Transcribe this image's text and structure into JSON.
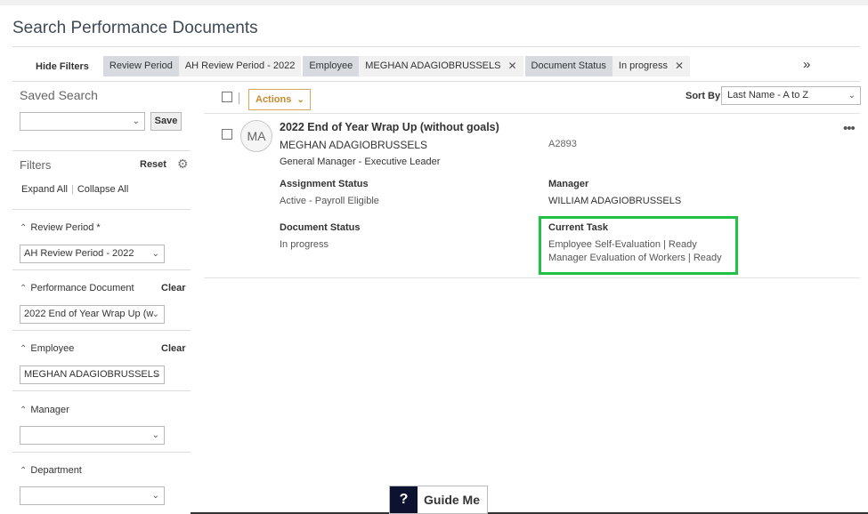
{
  "page": {
    "title": "Search Performance Documents"
  },
  "filterbar": {
    "hide_filters": "Hide Filters",
    "chips": [
      {
        "label": "Review Period",
        "value": "AH Review Period - 2022",
        "closable": false
      },
      {
        "label": "Employee",
        "value": "MEGHAN ADAGIOBRUSSELS",
        "closable": true
      },
      {
        "label": "Document Status",
        "value": "In progress",
        "closable": true
      }
    ],
    "overflow": "»",
    "close_glyph": "✕"
  },
  "sidebar": {
    "saved_search_title": "Saved Search",
    "saved_search_value": "",
    "save_label": "Save",
    "filters_title": "Filters",
    "reset_label": "Reset",
    "expand_all": "Expand All",
    "collapse_all": "Collapse All",
    "sections": [
      {
        "label": "Review Period *",
        "clear": "",
        "value": "AH Review Period - 2022"
      },
      {
        "label": "Performance Document",
        "clear": "Clear",
        "value": "2022 End of Year Wrap Up (w"
      },
      {
        "label": "Employee",
        "clear": "Clear",
        "value": "MEGHAN ADAGIOBRUSSELS"
      },
      {
        "label": "Manager",
        "clear": "",
        "value": ""
      },
      {
        "label": "Department",
        "clear": "",
        "value": ""
      }
    ]
  },
  "toolbar": {
    "actions_label": "Actions",
    "sort_by_label": "Sort By",
    "sort_value": "Last Name - A to Z"
  },
  "result": {
    "avatar_initials": "MA",
    "title": "2022 End of Year Wrap Up (without goals)",
    "employee_name": "MEGHAN ADAGIOBRUSSELS",
    "employee_id": "A2893",
    "role": "General Manager - Executive Leader",
    "assignment_status_label": "Assignment Status",
    "assignment_status_value": "Active - Payroll Eligible",
    "manager_label": "Manager",
    "manager_value": "WILLIAM ADAGIOBRUSSELS",
    "document_status_label": "Document Status",
    "document_status_value": "In progress",
    "current_task_label": "Current Task",
    "current_task_1": "Employee Self-Evaluation | Ready",
    "current_task_2": "Manager Evaluation of Workers | Ready",
    "more_glyph": "•••"
  },
  "guide": {
    "icon": "?",
    "label": "Guide Me"
  },
  "colors": {
    "accent_orange": "#c78a2c",
    "highlight_green": "#21c244",
    "guide_navy": "#0d1230"
  }
}
